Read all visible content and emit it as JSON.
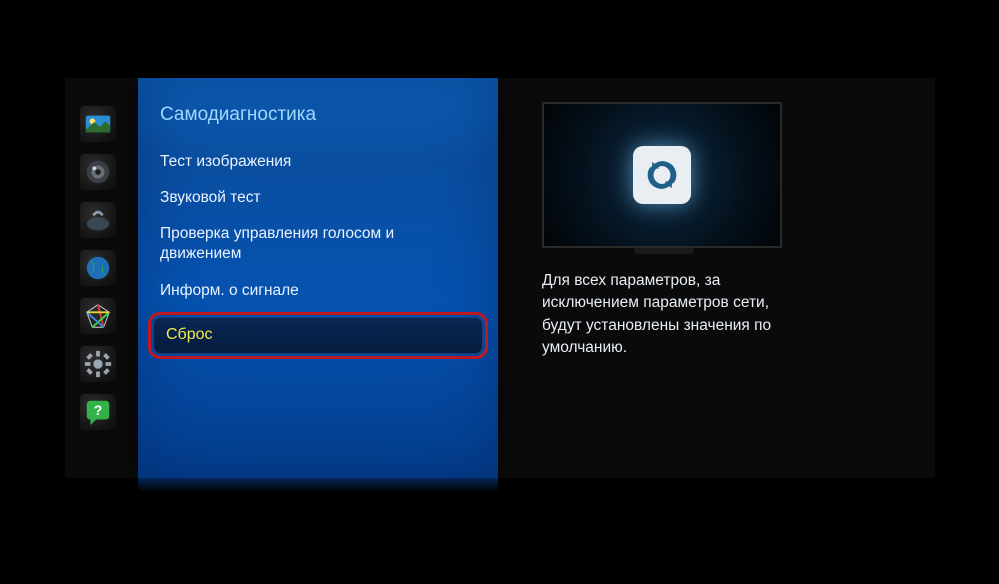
{
  "menu": {
    "title": "Самодиагностика",
    "items": [
      {
        "label": "Тест изображения"
      },
      {
        "label": "Звуковой тест"
      },
      {
        "label": "Проверка управления голосом и движением"
      },
      {
        "label": "Информ. о сигнале"
      },
      {
        "label": "Сброс"
      }
    ]
  },
  "description": "Для всех параметров, за исключением параметров сети, будут установлены значения по умолчанию.",
  "sidebar_icons": [
    "picture-icon",
    "sound-icon",
    "network-icon",
    "broadcast-icon",
    "smart-hub-icon",
    "settings-icon",
    "support-icon"
  ],
  "preview_icon": "reset-icon"
}
